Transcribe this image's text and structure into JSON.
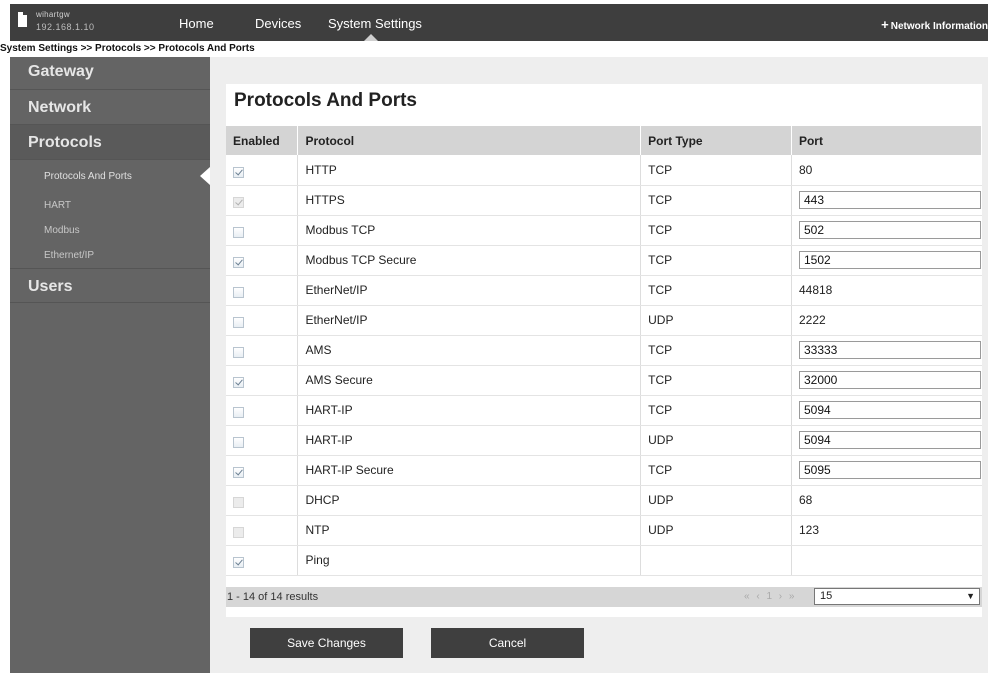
{
  "header": {
    "device_name": "wihartgw",
    "device_ip": "192.168.1.10",
    "nav": [
      "Home",
      "Devices",
      "System Settings"
    ],
    "network_info": "Network Information"
  },
  "breadcrumb": "System Settings >> Protocols >> Protocols And Ports",
  "sidebar": {
    "gateway": "Gateway",
    "network": "Network",
    "protocols": "Protocols",
    "sub_items": [
      "Protocols And Ports",
      "HART",
      "Modbus",
      "Ethernet/IP"
    ],
    "users": "Users"
  },
  "page_title": "Protocols And Ports",
  "table": {
    "columns": [
      "Enabled",
      "Protocol",
      "Port Type",
      "Port"
    ],
    "rows": [
      {
        "enabled": true,
        "locked": false,
        "protocol": "HTTP",
        "type": "TCP",
        "port": "80",
        "editable": false
      },
      {
        "enabled": true,
        "locked": true,
        "protocol": "HTTPS",
        "type": "TCP",
        "port": "443",
        "editable": true
      },
      {
        "enabled": false,
        "locked": false,
        "protocol": "Modbus TCP",
        "type": "TCP",
        "port": "502",
        "editable": true
      },
      {
        "enabled": true,
        "locked": false,
        "protocol": "Modbus TCP Secure",
        "type": "TCP",
        "port": "1502",
        "editable": true
      },
      {
        "enabled": false,
        "locked": false,
        "protocol": "EtherNet/IP",
        "type": "TCP",
        "port": "44818",
        "editable": false
      },
      {
        "enabled": false,
        "locked": false,
        "protocol": "EtherNet/IP",
        "type": "UDP",
        "port": "2222",
        "editable": false
      },
      {
        "enabled": false,
        "locked": false,
        "protocol": "AMS",
        "type": "TCP",
        "port": "33333",
        "editable": true
      },
      {
        "enabled": true,
        "locked": false,
        "protocol": "AMS Secure",
        "type": "TCP",
        "port": "32000",
        "editable": true
      },
      {
        "enabled": false,
        "locked": false,
        "protocol": "HART-IP",
        "type": "TCP",
        "port": "5094",
        "editable": true
      },
      {
        "enabled": false,
        "locked": false,
        "protocol": "HART-IP",
        "type": "UDP",
        "port": "5094",
        "editable": true
      },
      {
        "enabled": true,
        "locked": false,
        "protocol": "HART-IP Secure",
        "type": "TCP",
        "port": "5095",
        "editable": true
      },
      {
        "enabled": false,
        "locked": true,
        "protocol": "DHCP",
        "type": "UDP",
        "port": "68",
        "editable": false
      },
      {
        "enabled": false,
        "locked": true,
        "protocol": "NTP",
        "type": "UDP",
        "port": "123",
        "editable": false
      },
      {
        "enabled": true,
        "locked": false,
        "protocol": "Ping",
        "type": "",
        "port": "",
        "editable": false
      }
    ]
  },
  "pager": {
    "summary": "1 - 14 of 14 results",
    "nav": "« ‹ 1 › »",
    "page_size": "15"
  },
  "buttons": {
    "save": "Save Changes",
    "cancel": "Cancel"
  }
}
